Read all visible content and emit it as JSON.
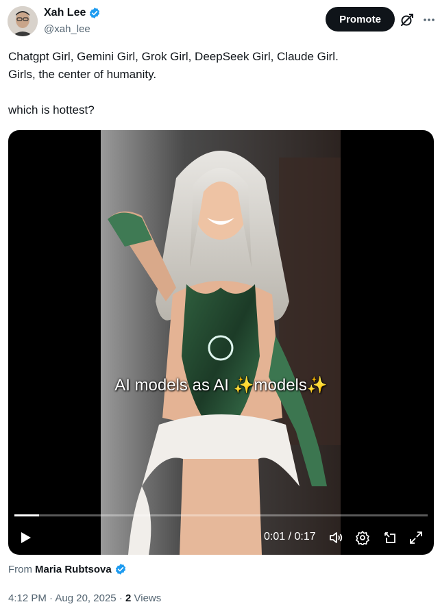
{
  "author": {
    "display_name": "Xah Lee",
    "handle": "@xah_lee"
  },
  "actions": {
    "promote_label": "Promote"
  },
  "tweet": {
    "lines": [
      "Chatgpt Girl, Gemini Girl, Grok Girl, DeepSeek Girl, Claude Girl.",
      "Girls, the center of humanity.",
      "which is hottest?"
    ]
  },
  "video": {
    "caption": "AI models as AI ✨models✨",
    "current_time": "0:01",
    "separator": "/",
    "duration": "0:17",
    "progress_fraction": 0.06,
    "icons": [
      "play-icon",
      "volume-icon",
      "settings-icon",
      "pip-icon",
      "fullscreen-icon"
    ]
  },
  "source": {
    "label": "From",
    "name": "Maria Rubtsova"
  },
  "meta": {
    "time": "4:12 PM",
    "dot": "·",
    "date": "Aug 20, 2025",
    "views_count": "2",
    "views_label": "Views"
  },
  "colors": {
    "verified": "#1d9bf0",
    "secondary_text": "#536471",
    "button_dark": "#0f1419"
  }
}
